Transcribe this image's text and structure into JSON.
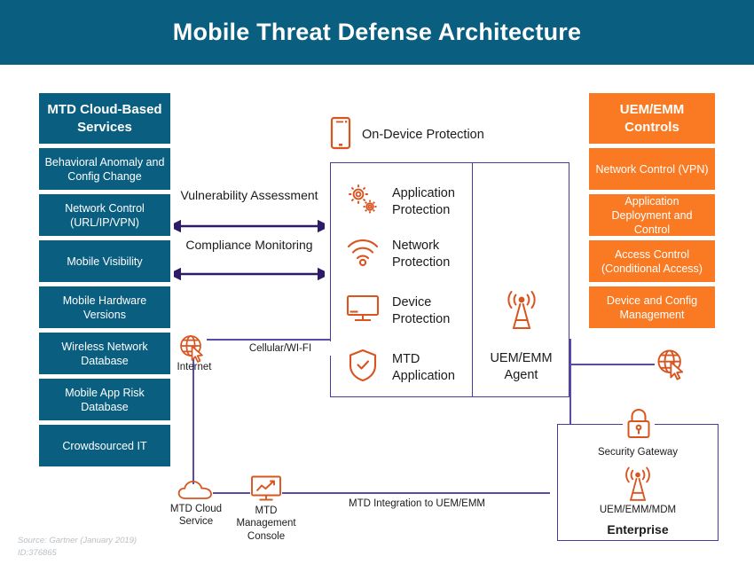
{
  "header": {
    "title": "Mobile Threat Defense Architecture",
    "bg_color": "#0a5e80"
  },
  "colors": {
    "teal": "#0a5e80",
    "orange": "#f97a22",
    "icon_orange": "#d9541e",
    "purple": "#4b3a99",
    "line_purple": "#5b4ba8",
    "text": "#1b1b1b",
    "source_gray": "#b9bfc4"
  },
  "left_column": {
    "header": "MTD Cloud-Based Services",
    "items": [
      "Behavioral Anomaly and Config Change",
      "Network Control (URL/IP/VPN)",
      "Mobile Visibility",
      "Mobile Hardware Versions",
      "Wireless Network Database",
      "Mobile App Risk Database",
      "Crowdsourced IT"
    ]
  },
  "right_column": {
    "header": "UEM/EMM Controls",
    "items": [
      "Network Control (VPN)",
      "Application Deployment and Control",
      "Access Control (Conditional Access)",
      "Device and Config Management"
    ]
  },
  "center": {
    "on_device_label": "On-Device Protection",
    "on_device_icon": "mobile-phone-icon",
    "items": [
      {
        "label": "Application Protection",
        "icon": "gears-icon"
      },
      {
        "label": "Network Protection",
        "icon": "wifi-icon"
      },
      {
        "label": "Device Protection",
        "icon": "monitor-icon"
      },
      {
        "label": "MTD Application",
        "icon": "shield-check-icon"
      }
    ],
    "agent": {
      "label": "UEM/EMM Agent",
      "icon": "antenna-tower-icon"
    }
  },
  "arrows": [
    {
      "label": "Vulnerability Assessment",
      "direction": "bidirectional"
    },
    {
      "label": "Compliance Monitoring",
      "direction": "bidirectional"
    }
  ],
  "network": {
    "internet_label": "Internet",
    "internet_icon": "globe-cursor-icon",
    "cellular_label": "Cellular/WI-FI",
    "external_globe_icon": "globe-cursor-icon"
  },
  "bottom": {
    "cloud": {
      "label": "MTD Cloud Service",
      "icon": "cloud-icon"
    },
    "console": {
      "label": "MTD Management Console",
      "icon": "chart-monitor-icon"
    },
    "integration_label": "MTD Integration to UEM/EMM"
  },
  "enterprise": {
    "gateway_label": "Security Gateway",
    "gateway_icon": "padlock-icon",
    "uem_label": "UEM/EMM/MDM",
    "uem_icon": "antenna-tower-icon",
    "title": "Enterprise"
  },
  "source": {
    "line1": "Source: Gartner (January 2019)",
    "line2": "ID:376865"
  }
}
